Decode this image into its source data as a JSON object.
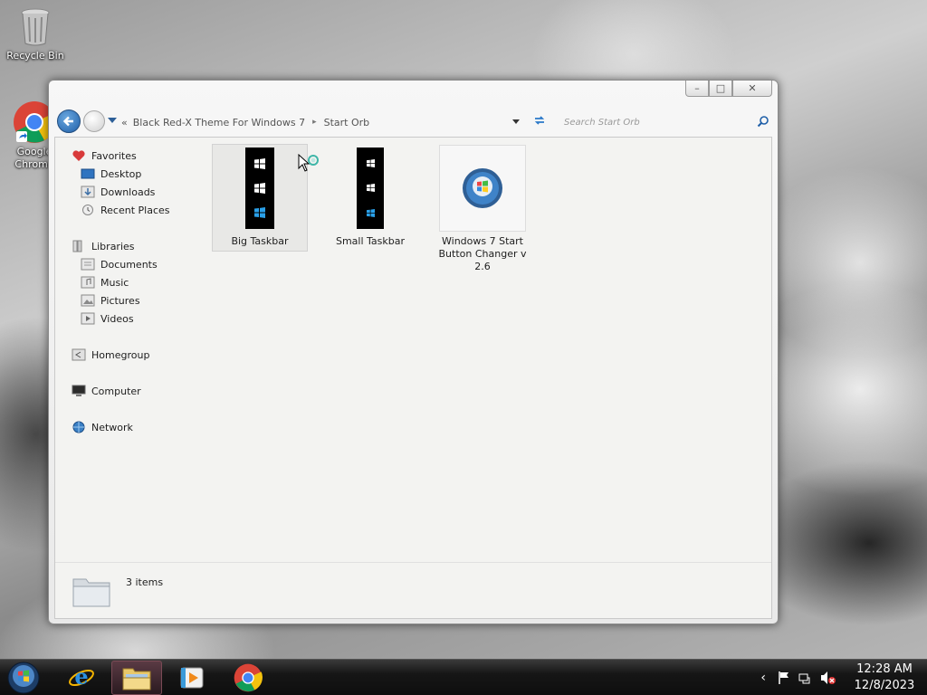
{
  "desktop": {
    "icons": [
      {
        "label": "Recycle Bin",
        "icon": "recycle-bin-icon"
      },
      {
        "label": "Google Chrome",
        "icon": "chrome-icon"
      }
    ]
  },
  "window": {
    "buttons": {
      "minimize": "–",
      "maximize": "□",
      "close": "✕"
    },
    "address": {
      "crumbs": [
        "Black Red-X Theme For Windows 7",
        "Start Orb"
      ],
      "separator_glyph": "▸",
      "prefix_glyph": "«"
    },
    "search": {
      "placeholder": "Search Start Orb"
    },
    "nav": {
      "favorites": {
        "label": "Favorites",
        "items": [
          "Desktop",
          "Downloads",
          "Recent Places"
        ]
      },
      "libraries": {
        "label": "Libraries",
        "items": [
          "Documents",
          "Music",
          "Pictures",
          "Videos"
        ]
      },
      "homegroup": "Homegroup",
      "computer": "Computer",
      "network": "Network"
    },
    "files": [
      {
        "name": "Big Taskbar",
        "selected": true,
        "icon": "big-taskbar-thumbnail"
      },
      {
        "name": "Small Taskbar",
        "selected": false,
        "icon": "small-taskbar-thumbnail"
      },
      {
        "name": "Windows 7 Start Button Changer v 2.6",
        "selected": false,
        "icon": "start-button-changer-icon"
      }
    ],
    "status": {
      "count": "3 items"
    }
  },
  "taskbar": {
    "pinned": [
      "start-orb",
      "internet-explorer-icon",
      "windows-explorer-icon",
      "media-player-icon",
      "chrome-icon"
    ],
    "active": "windows-explorer-icon",
    "tray": {
      "time": "12:28 AM",
      "date": "12/8/2023",
      "show_hidden": "‹"
    }
  },
  "colors": {
    "accent_blue": "#1f5fa8",
    "taskbar": "#161616",
    "active_task": "#7a4a55"
  }
}
